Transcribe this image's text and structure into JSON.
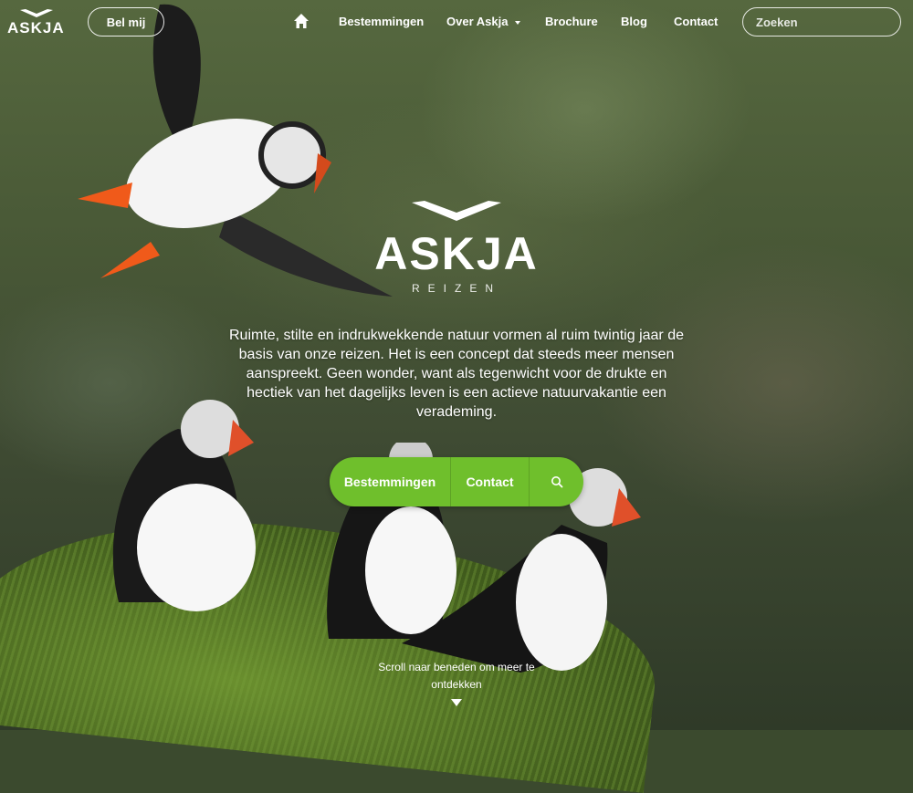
{
  "brand": {
    "name": "ASKJA",
    "tagline": "REIZEN"
  },
  "nav": {
    "call_button": "Bel mij",
    "items": [
      {
        "label": "Bestemmingen"
      },
      {
        "label": "Over Askja"
      },
      {
        "label": "Brochure"
      },
      {
        "label": "Blog"
      },
      {
        "label": "Contact"
      }
    ],
    "search_placeholder": "Zoeken"
  },
  "hero": {
    "intro": "Ruimte, stilte en indrukwekkende natuur vormen al ruim twintig jaar de basis van onze reizen. Het is een concept dat steeds meer mensen aanspreekt. Geen wonder, want als tegenwicht voor de drukte en hectiek van het dagelijks leven is een actieve natuurvakantie een verademing.",
    "buttons": {
      "destinations": "Bestemmingen",
      "contact": "Contact"
    },
    "scroll_hint": "Scroll naar beneden om meer te ontdekken"
  },
  "colors": {
    "accent": "#6fbf2c",
    "text": "#ffffff"
  },
  "icons": {
    "home": "home-icon",
    "search": "search-icon",
    "dropdown": "caret-down-icon",
    "scroll": "arrow-down-icon"
  }
}
